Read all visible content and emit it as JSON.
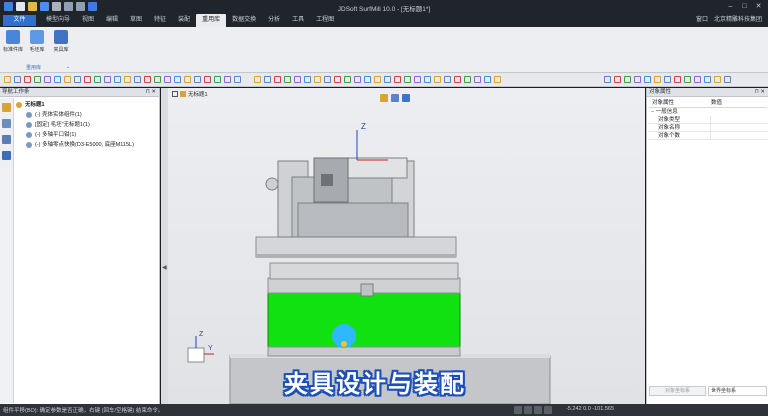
{
  "app": {
    "title": "JDSoft SurfMill 10.0 - [无标题1*]"
  },
  "menu": {
    "file": "文件",
    "tabs": [
      "模型向导",
      "视图",
      "编辑",
      "草图",
      "特征",
      "装配",
      "重用库",
      "数据交换",
      "分析",
      "工具",
      "工程图"
    ],
    "active_tab": "重用库",
    "right_items": [
      "窗口",
      "北京精雕科技集团"
    ]
  },
  "ribbon": {
    "buttons": [
      "标准件库",
      "毛坯库",
      "夹具库"
    ],
    "group_label": "重用库"
  },
  "left_panel": {
    "title": "导航工作条",
    "tree": [
      {
        "label": "无标题1",
        "level": 0
      },
      {
        "label": "(-) 壳体实体组件(1)",
        "level": 1
      },
      {
        "label": "[固定] 毛坯\"无标题1(1)",
        "level": 1
      },
      {
        "label": "(-) 多轴平口钳(1)",
        "level": 1
      },
      {
        "label": "(-) 多轴零点快换(D3-E5000, 底座M115L)",
        "level": 1
      }
    ]
  },
  "viewport": {
    "tab": "无标题1",
    "axis_z": "Z",
    "axis_x": "X",
    "axis_y": "Y",
    "caption": "夹具设计与装配"
  },
  "right_panel": {
    "title": "对象属性",
    "col_name": "对象属性",
    "col_value": "数值",
    "group": "一般信息",
    "rows": [
      {
        "name": "对象类型",
        "value": ""
      },
      {
        "name": "对象名称",
        "value": ""
      },
      {
        "name": "对象个数",
        "value": ""
      }
    ],
    "bottom_left": "对象坐标系",
    "bottom_right": "世界坐标系"
  },
  "status": {
    "message": "组件平移(BO): 确定参数是否正确，右键 (回车/空格键) 结束命令。",
    "coords": "-5.242 0.0 -101.565"
  },
  "colors": {
    "accent": "#2e6fd0",
    "fixture_green": "#11e011",
    "highlight": "#2db8ff"
  }
}
